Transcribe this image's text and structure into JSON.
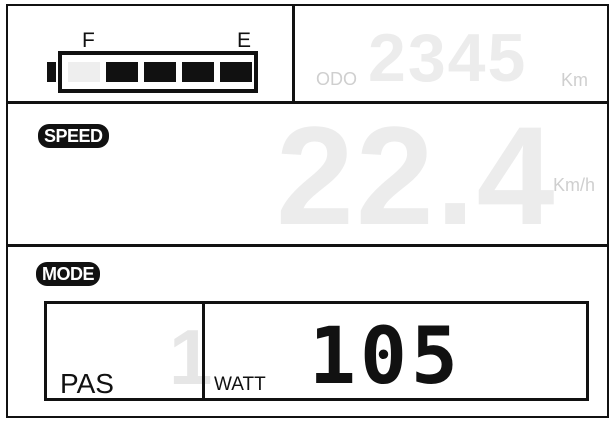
{
  "battery": {
    "full_label": "F",
    "empty_label": "E",
    "segments_total": 5,
    "segments_filled": 4
  },
  "odometer": {
    "label": "ODO",
    "value": "2345",
    "unit": "Km"
  },
  "speed": {
    "label": "SPEED",
    "value": "22.4",
    "unit": "Km/h"
  },
  "mode": {
    "label": "MODE",
    "pas_label": "PAS",
    "pas_value": "1",
    "watt_label": "WATT",
    "watt_value": "105"
  },
  "colors": {
    "ink": "#111111",
    "ghost": "#ececec",
    "background": "#ffffff"
  }
}
